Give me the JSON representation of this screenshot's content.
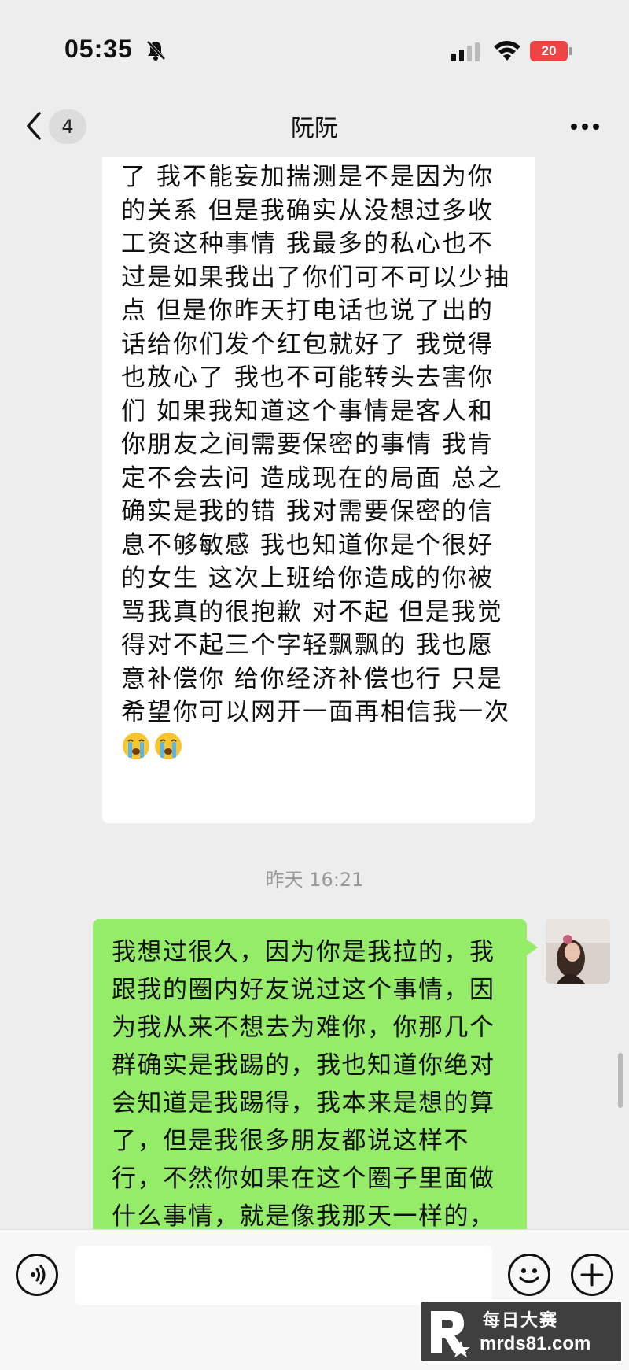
{
  "status_bar": {
    "time": "05:35",
    "battery_level": "20"
  },
  "header": {
    "back_badge": "4",
    "title": "阮阮"
  },
  "messages": [
    {
      "side": "incoming",
      "text": "了 我不能妄加揣测是不是因为你的关系 但是我确实从没想过多收工资这种事情 我最多的私心也不过是如果我出了你们可不可以少抽点 但是你昨天打电话也说了出的话给你们发个红包就好了 我觉得也放心了 我也不可能转头去害你们 如果我知道这个事情是客人和你朋友之间需要保密的事情 我肯定不会去问 造成现在的局面 总之确实是我的错 我对需要保密的信息不够敏感 我也知道你是个很好的女生 这次上班给你造成的你被骂我真的很抱歉 对不起 但是我觉得对不起三个字轻飘飘的 我也愿意补偿你 给你经济补偿也行 只是希望你可以网开一面再相信我一次",
      "emojis": [
        "crying-face",
        "crying-face"
      ]
    },
    {
      "side": "outgoing",
      "text": "我想过很久，因为你是我拉的，我跟我的圈内好友说过这个事情，因为我从来不想去为难你，你那几个群确实是我踢的，我也知道你绝对会知道是我踢得，我本来是想的算了，但是我很多朋友都说这样不行，不然你如果在这个圈子里面做什么事情，就是像我那天一样的，"
    }
  ],
  "timestamp": "昨天 16:21",
  "input_bar": {
    "placeholder": ""
  },
  "watermark": {
    "title": "每日大赛",
    "url": "mrds81.com"
  },
  "colors": {
    "background": "#ededed",
    "incoming_bubble": "#ffffff",
    "outgoing_bubble": "#95ec69",
    "battery_low": "#ee4444"
  }
}
